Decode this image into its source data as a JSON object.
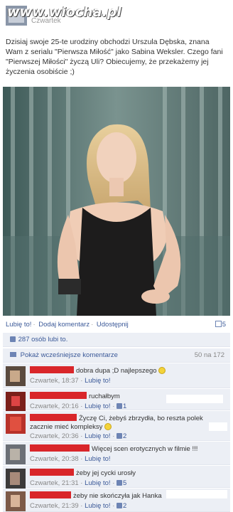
{
  "watermark": "www.wiocha.pl",
  "header": {
    "date": "Czwartek"
  },
  "post": {
    "text": "Dzisiaj swoje 25-te urodziny obchodzi Urszula Dębska, znana Wam z serialu \"Pierwsza Miłość\" jako Sabina Weksler. Czego fani \"Pierwszej Miłości\" życzą Uli? Obiecujemy, że przekażemy jej życzenia osobiście ;)"
  },
  "actions": {
    "like": "Lubię to!",
    "comment": "Dodaj komentarz",
    "share": "Udostępnij",
    "share_count": "5"
  },
  "likes": {
    "text": "287 osób lubi to."
  },
  "comments_header": {
    "show_previous": "Pokaż wcześniejsze komentarze",
    "count": "50 na 172"
  },
  "comments": [
    {
      "text": "dobra dupa ;D najlepszego",
      "date": "Czwartek, 18:37",
      "like": "Lubię to!",
      "likes": ""
    },
    {
      "text": "ruchałbym",
      "date": "Czwartek, 20:16",
      "like": "Lubię to!",
      "likes": "1"
    },
    {
      "text": "Życzę Ci, żebyś zbrzydła, bo reszta polek zacznie mieć kompleksy",
      "date": "Czwartek, 20:36",
      "like": "Lubię to!",
      "likes": "2"
    },
    {
      "text": "Więcej scen erotycznych w filmie !!!",
      "date": "Czwartek, 20:38",
      "like": "Lubię to!",
      "likes": ""
    },
    {
      "text": "żeby jej cycki urosły",
      "date": "Czwartek, 21:31",
      "like": "Lubię to!",
      "likes": "5"
    },
    {
      "text": "żeby nie skończyła jak Hanka",
      "date": "Czwartek, 21:39",
      "like": "Lubię to!",
      "likes": "2"
    }
  ]
}
